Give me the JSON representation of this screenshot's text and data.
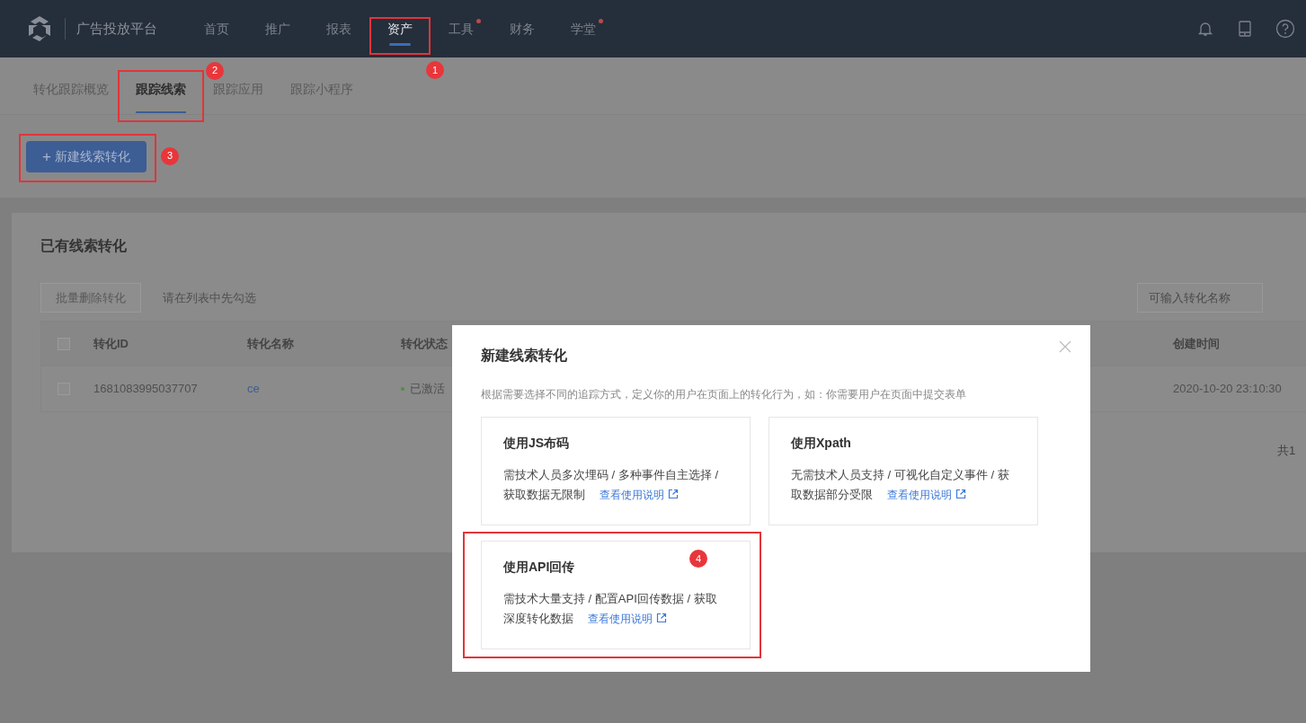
{
  "nav": {
    "title": "广告投放平台",
    "items": [
      {
        "label": "首页",
        "selected": false,
        "dot": false
      },
      {
        "label": "推广",
        "selected": false,
        "dot": false
      },
      {
        "label": "报表",
        "selected": false,
        "dot": false
      },
      {
        "label": "资产",
        "selected": true,
        "dot": false,
        "annotation": "1"
      },
      {
        "label": "工具",
        "selected": false,
        "dot": true
      },
      {
        "label": "财务",
        "selected": false,
        "dot": false
      },
      {
        "label": "学堂",
        "selected": false,
        "dot": true
      }
    ]
  },
  "subtabs": [
    {
      "label": "转化跟踪概览",
      "selected": false
    },
    {
      "label": "跟踪线索",
      "selected": true,
      "annotation": "2"
    },
    {
      "label": "跟踪应用",
      "selected": false
    },
    {
      "label": "跟踪小程序",
      "selected": false
    }
  ],
  "new_button": {
    "icon": "+",
    "label": "新建线索转化",
    "annotation": "3"
  },
  "panel": {
    "title": "已有线索转化",
    "batch_delete": "批量删除转化",
    "hint": "请在列表中先勾选",
    "search": {
      "placeholder": "可输入转化名称"
    },
    "all_checked": false,
    "columns": [
      "转化ID",
      "转化名称",
      "转化状态",
      "创建时间"
    ],
    "rows": [
      {
        "checked": false,
        "id": "1681083995037707",
        "name": "ce",
        "status": "已激活",
        "created": "2020-10-20 23:10:30"
      }
    ],
    "total": "共1"
  },
  "modal": {
    "title": "新建线索转化",
    "description": "根据需要选择不同的追踪方式，定义你的用户在页面上的转化行为，如：你需要用户在页面中提交表单",
    "options": [
      {
        "title": "使用JS布码",
        "text": "需技术人员多次埋码 / 多种事件自主选择 / 获取数据无限制",
        "link": "查看使用说明"
      },
      {
        "title": "使用Xpath",
        "text": "无需技术人员支持 / 可视化自定义事件 / 获取数据部分受限",
        "link": "查看使用说明"
      },
      {
        "title": "使用API回传",
        "text": "需技术大量支持 / 配置API回传数据 / 获取深度转化数据",
        "link": "查看使用说明",
        "annotation": "4"
      }
    ]
  }
}
